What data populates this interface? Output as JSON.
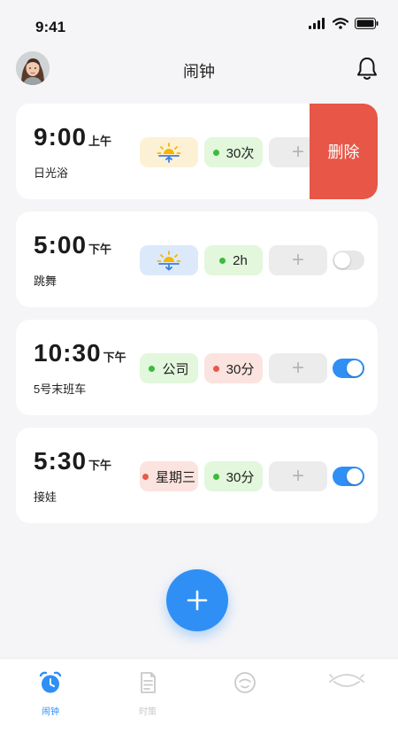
{
  "status_bar": {
    "time": "9:41"
  },
  "header": {
    "title": "闹钟"
  },
  "alarms": [
    {
      "time": "9:00",
      "ampm": "上午",
      "label": "日光浴",
      "chips": [
        "30次"
      ],
      "delete_label": "删除"
    },
    {
      "time": "5:00",
      "ampm": "下午",
      "label": "跳舞",
      "chips": [
        "2h"
      ],
      "enabled": false
    },
    {
      "time": "10:30",
      "ampm": "下午",
      "label": "5号末班车",
      "chips": [
        "公司",
        "30分"
      ],
      "enabled": true
    },
    {
      "time": "5:30",
      "ampm": "下午",
      "label": "接娃",
      "chips": [
        "星期三",
        "30分"
      ],
      "enabled": true
    }
  ],
  "add_chip_label": "+",
  "bottom_nav": {
    "items": [
      {
        "label": "闹钟",
        "active": true
      },
      {
        "label": "时策",
        "active": false
      },
      {
        "label": "",
        "active": false
      },
      {
        "label": "",
        "active": false
      }
    ]
  },
  "colors": {
    "accent": "#2f8ff5",
    "delete": "#e75646",
    "dot_green": "#3dbb3d",
    "dot_red": "#e65a4b"
  }
}
